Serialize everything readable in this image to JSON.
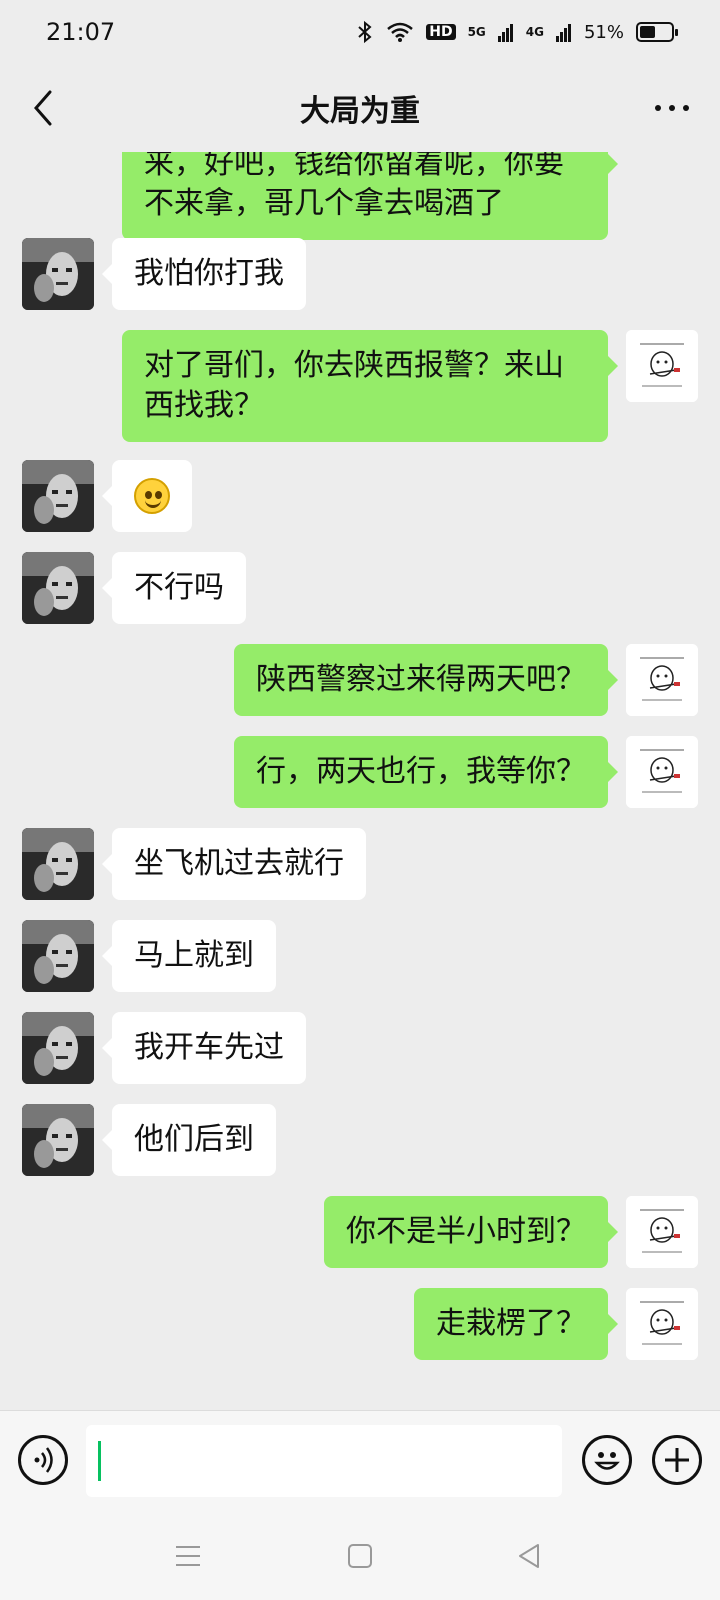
{
  "status_bar": {
    "time": "21:07",
    "network_5g": "5G",
    "network_4g": "4G",
    "hd_label": "HD",
    "battery_percent": "51%",
    "battery_level": 0.51
  },
  "header": {
    "title": "大局为重",
    "back_icon": "chevron-left-icon",
    "more_icon": "more-dots-icon"
  },
  "messages": [
    {
      "side": "right",
      "text": "来，好吧，钱给你留着呢，你要不来拿，哥几个拿去喝酒了",
      "partial": true
    },
    {
      "side": "left",
      "text": "我怕你打我"
    },
    {
      "side": "right",
      "text": "对了哥们，你去陕西报警？来山西找我？"
    },
    {
      "side": "left",
      "type": "emoji",
      "emoji": "smile-emoji"
    },
    {
      "side": "left",
      "text": "不行吗"
    },
    {
      "side": "right",
      "text": "陕西警察过来得两天吧？"
    },
    {
      "side": "right",
      "text": "行，两天也行，我等你？"
    },
    {
      "side": "left",
      "text": "坐飞机过去就行"
    },
    {
      "side": "left",
      "text": "马上就到"
    },
    {
      "side": "left",
      "text": "我开车先过"
    },
    {
      "side": "left",
      "text": "他们后到"
    },
    {
      "side": "right",
      "text": "你不是半小时到？"
    },
    {
      "side": "right",
      "text": "走栽楞了？"
    }
  ],
  "input_bar": {
    "voice_icon": "voice-icon",
    "input_value": "",
    "emoji_icon": "emoji-icon",
    "plus_icon": "plus-icon"
  },
  "nav_bar": {
    "menu_icon": "menu-icon",
    "home_icon": "home-square-icon",
    "back_icon": "back-triangle-icon"
  },
  "colors": {
    "background": "#ededed",
    "bubble_self": "#95ec69",
    "bubble_other": "#ffffff",
    "caret": "#07c160"
  }
}
